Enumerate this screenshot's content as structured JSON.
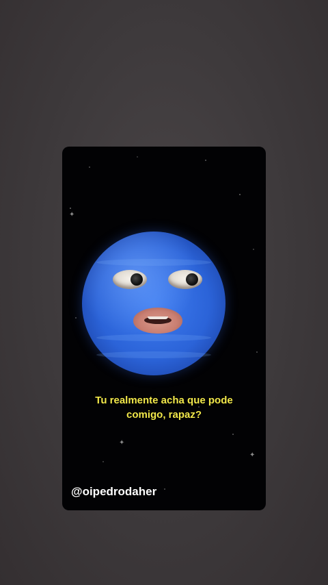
{
  "video": {
    "subtitle_line1": "Tu realmente acha que pode",
    "subtitle_line2": "comigo, rapaz?",
    "creator_handle": "@oipedrodaher"
  },
  "colors": {
    "background": "#3d393b",
    "video_background": "#020204",
    "subtitle": "#f2e84a",
    "planet": "#2b63d8",
    "handle": "#ffffff"
  },
  "icons": {
    "sparkle": "sparkle-star-icon"
  }
}
